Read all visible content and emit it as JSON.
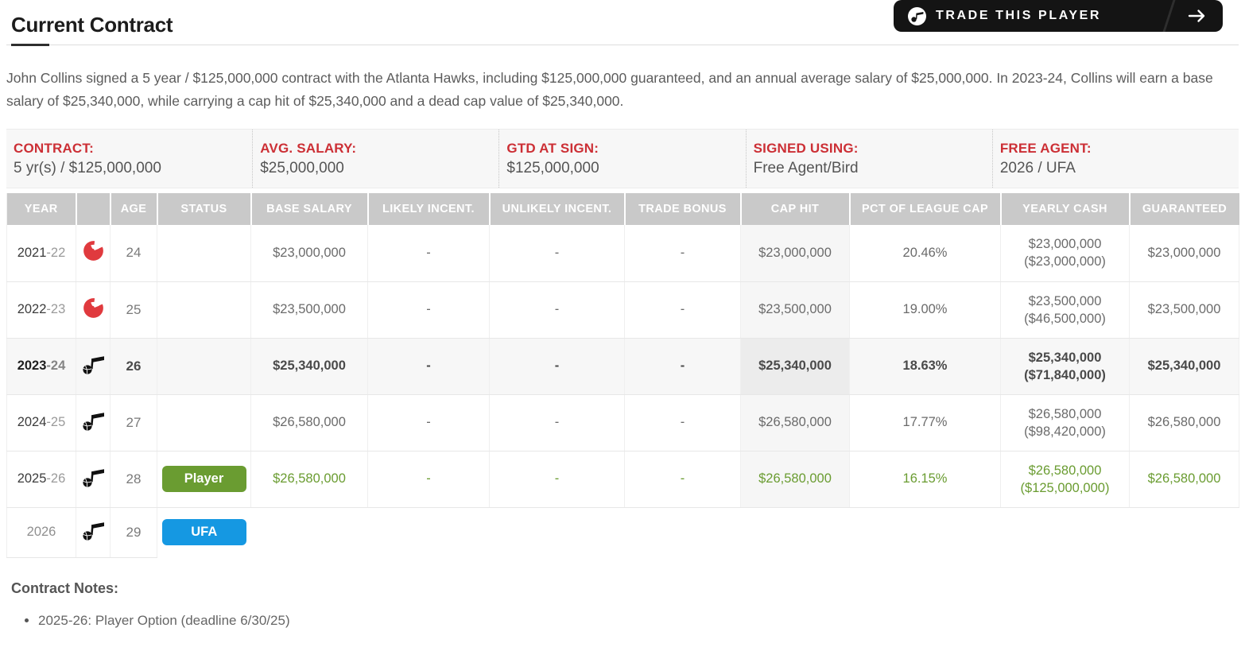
{
  "header": {
    "title": "Current Contract",
    "trade_button": {
      "label": "TRADE THIS PLAYER"
    }
  },
  "intro": "John Collins signed a 5 year / $125,000,000 contract with the Atlanta Hawks, including $125,000,000 guaranteed, and an annual average salary of $25,000,000. In 2023-24, Collins will earn a base salary of $25,340,000, while carrying a cap hit of $25,340,000 and a dead cap value of $25,340,000.",
  "summary": [
    {
      "label": "CONTRACT:",
      "value": "5 yr(s) / $125,000,000"
    },
    {
      "label": "AVG. SALARY:",
      "value": "$25,000,000"
    },
    {
      "label": "GTD AT SIGN:",
      "value": "$125,000,000"
    },
    {
      "label": "SIGNED USING:",
      "value": "Free Agent/Bird"
    },
    {
      "label": "FREE AGENT:",
      "value": "2026 / UFA"
    }
  ],
  "table": {
    "columns": [
      "YEAR",
      "",
      "AGE",
      "STATUS",
      "BASE SALARY",
      "LIKELY INCENT.",
      "UNLIKELY INCENT.",
      "TRADE BONUS",
      "CAP HIT",
      "PCT OF LEAGUE CAP",
      "YEARLY CASH",
      "GUARANTEED"
    ],
    "rows": [
      {
        "year": "2021",
        "year_suffix": "-22",
        "team": "ATL",
        "age": "24",
        "status": "",
        "base_salary": "$23,000,000",
        "likely_incent": "-",
        "unlikely_incent": "-",
        "trade_bonus": "-",
        "cap_hit": "$23,000,000",
        "pct_of_cap": "20.46%",
        "yearly_cash": "$23,000,000",
        "yearly_cash_total": "($23,000,000)",
        "guaranteed": "$23,000,000",
        "current": false,
        "option": false,
        "partial": false
      },
      {
        "year": "2022",
        "year_suffix": "-23",
        "team": "ATL",
        "age": "25",
        "status": "",
        "base_salary": "$23,500,000",
        "likely_incent": "-",
        "unlikely_incent": "-",
        "trade_bonus": "-",
        "cap_hit": "$23,500,000",
        "pct_of_cap": "19.00%",
        "yearly_cash": "$23,500,000",
        "yearly_cash_total": "($46,500,000)",
        "guaranteed": "$23,500,000",
        "current": false,
        "option": false,
        "partial": false
      },
      {
        "year": "2023",
        "year_suffix": "-24",
        "team": "UTA",
        "age": "26",
        "status": "",
        "base_salary": "$25,340,000",
        "likely_incent": "-",
        "unlikely_incent": "-",
        "trade_bonus": "-",
        "cap_hit": "$25,340,000",
        "pct_of_cap": "18.63%",
        "yearly_cash": "$25,340,000",
        "yearly_cash_total": "($71,840,000)",
        "guaranteed": "$25,340,000",
        "current": true,
        "option": false,
        "partial": false
      },
      {
        "year": "2024",
        "year_suffix": "-25",
        "team": "UTA",
        "age": "27",
        "status": "",
        "base_salary": "$26,580,000",
        "likely_incent": "-",
        "unlikely_incent": "-",
        "trade_bonus": "-",
        "cap_hit": "$26,580,000",
        "pct_of_cap": "17.77%",
        "yearly_cash": "$26,580,000",
        "yearly_cash_total": "($98,420,000)",
        "guaranteed": "$26,580,000",
        "current": false,
        "option": false,
        "partial": false
      },
      {
        "year": "2025",
        "year_suffix": "-26",
        "team": "UTA",
        "age": "28",
        "status": "Player",
        "base_salary": "$26,580,000",
        "likely_incent": "-",
        "unlikely_incent": "-",
        "trade_bonus": "-",
        "cap_hit": "$26,580,000",
        "pct_of_cap": "16.15%",
        "yearly_cash": "$26,580,000",
        "yearly_cash_total": "($125,000,000)",
        "guaranteed": "$26,580,000",
        "current": false,
        "option": true,
        "partial": false
      },
      {
        "year": "2026",
        "year_suffix": "",
        "team": "UTA",
        "age": "29",
        "status": "UFA",
        "base_salary": "",
        "likely_incent": "",
        "unlikely_incent": "",
        "trade_bonus": "",
        "cap_hit": "",
        "pct_of_cap": "",
        "yearly_cash": "",
        "yearly_cash_total": "",
        "guaranteed": "",
        "current": false,
        "option": false,
        "partial": true
      }
    ]
  },
  "notes": {
    "title": "Contract Notes:",
    "items": [
      "2025-26: Player Option (deadline 6/30/25)"
    ]
  },
  "colors": {
    "accent_red": "#cc2f35",
    "hawks_red": "#e03a3e",
    "option_green": "#6a9c31",
    "ufa_blue": "#1598e2",
    "header_gray": "#c9c9c9"
  }
}
